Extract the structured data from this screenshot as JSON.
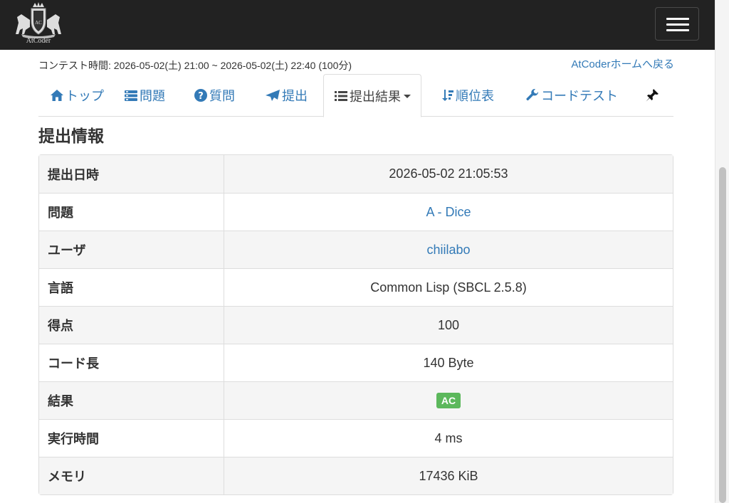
{
  "logo": {
    "text": "AtCoder"
  },
  "contest": {
    "time_label": "コンテスト時間: 2026-05-02(土) 21:00 ~ 2026-05-02(土) 22:40 (100分)",
    "home_link": "AtCoderホームへ戻る"
  },
  "tabs": [
    {
      "label": "トップ",
      "icon": "home-icon"
    },
    {
      "label": "問題",
      "icon": "tasks-icon"
    },
    {
      "label": "質問",
      "icon": "question-icon"
    },
    {
      "label": "提出",
      "icon": "send-icon"
    },
    {
      "label": "提出結果",
      "icon": "list-icon",
      "active": true
    },
    {
      "label": "順位表",
      "icon": "sort-icon"
    },
    {
      "label": "コードテスト",
      "icon": "wrench-icon"
    },
    {
      "label": "",
      "icon": "pin-icon"
    }
  ],
  "section_title": "提出情報",
  "submission": {
    "rows": [
      {
        "label": "提出日時",
        "value": "2026-05-02 21:05:53"
      },
      {
        "label": "問題",
        "value": "A - Dice",
        "link": true
      },
      {
        "label": "ユーザ",
        "value": "chiilabo",
        "link": true
      },
      {
        "label": "言語",
        "value": "Common Lisp (SBCL 2.5.8)"
      },
      {
        "label": "得点",
        "value": "100"
      },
      {
        "label": "コード長",
        "value": "140 Byte"
      },
      {
        "label": "結果",
        "value": "AC",
        "badge": true
      },
      {
        "label": "実行時間",
        "value": "4 ms"
      },
      {
        "label": "メモリ",
        "value": "17436 KiB"
      }
    ]
  },
  "colors": {
    "link": "#337ab7",
    "navbar": "#222222",
    "ac_badge": "#5cb85c"
  }
}
